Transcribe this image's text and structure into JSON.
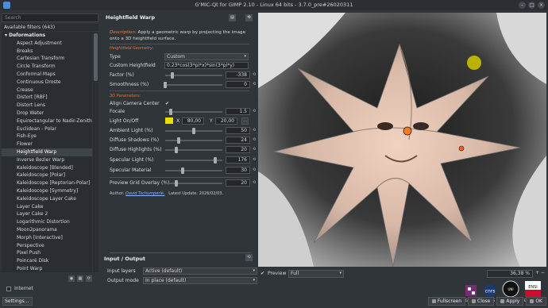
{
  "window": {
    "title": "G'MIC-Qt for GIMP 2.10 - Linux 64 bits - 3.7.0_pre#26020311",
    "controls": [
      "–",
      "□",
      "×"
    ]
  },
  "left": {
    "search_placeholder": "Search",
    "available": "Available filters (643)",
    "category": "Deformations",
    "items": [
      "Aspect Adjustment",
      "Breaks",
      "Cartesian Transform",
      "Circle Transform",
      "Conformal Maps",
      "Continuous Droste",
      "Crease",
      "Distort [RBF]",
      "Distort Lens",
      "Drop Water",
      "Equirectangular to Nadir-Zenith",
      "Euclidean - Polar",
      "Fish-Eye",
      "Flower",
      "Heightfield Warp",
      "Inverse Bezier Warp",
      "Kaleidoscope [Blended]",
      "Kaleidoscope [Polar]",
      "Kaleidoscope [Reptorian-Polar]",
      "Kaleidoscope [Symmetry]",
      "Kaleidoscope Layer Cake",
      "Layer Cake",
      "Layer Cake 2",
      "Logarithmic Distortion",
      "Moon2panorama",
      "Morph [Interactive]",
      "Perspective",
      "Pixel Push",
      "Poincaré Disk",
      "Point Warp"
    ],
    "selected_index": 14,
    "internet_label": "Internet",
    "settings_label": "Settings..."
  },
  "filter": {
    "name": "Heightfield Warp",
    "desc_label": "Description:",
    "desc_text": "Apply a geometric warp by projecting the image onto a 3D heightfield surface.",
    "sec_geometry": "Heightfield Geometry:",
    "type_label": "Type",
    "type_value": "Custom",
    "custom_label": "Custom Heightfield",
    "custom_value": "0.23*cos(3*pi*x)*sin(3*pi*y)",
    "factor_label": "Factor (%)",
    "factor_value": "-338",
    "factor_pos": 0.13,
    "smooth_label": "Smoothness (%)",
    "smooth_value": "0",
    "smooth_pos": 0.0,
    "sec_3d": "3D Parameters:",
    "align_label": "Align Camera Center",
    "align_checked": true,
    "focale_label": "Focale",
    "focale_value": "1.5",
    "focale_pos": 0.1,
    "light_label": "Light On/Off",
    "light_color": "#e8e000",
    "light_x_label": "X",
    "light_x": "80,00",
    "light_y_label": "Y",
    "light_y": "20,00",
    "ambient_label": "Ambient Light (%)",
    "ambient_value": "50",
    "ambient_pos": 0.5,
    "shadows_label": "Diffuse Shadows (%)",
    "shadows_value": "24",
    "shadows_pos": 0.24,
    "highlights_label": "Diffuse Highlights (%)",
    "highlights_value": "20",
    "highlights_pos": 0.2,
    "specular_label": "Specular Light (%)",
    "specular_value": "176",
    "specular_pos": 0.88,
    "material_label": "Specular Material",
    "material_value": "30",
    "material_pos": 0.3,
    "grid_label": "Preview Grid Overlay (%)",
    "grid_value": "20",
    "grid_pos": 0.2,
    "author_label": "Author:",
    "author_name": "David Tschumperlé.",
    "update": "Latest Update: 2026/02/03."
  },
  "io": {
    "title": "Input / Output",
    "layers_label": "Input layers",
    "layers_value": "Active (default)",
    "mode_label": "Output mode",
    "mode_value": "In place (default)"
  },
  "preview": {
    "label": "Preview",
    "checked": true,
    "mode": "Full",
    "zoom": "36,38 %",
    "logos": [
      "GREYC",
      "CNRS",
      "UNICAEN",
      "ENSICAEN"
    ]
  },
  "buttons": {
    "fullscreen": "Fullscreen",
    "close": "Close",
    "apply": "Apply",
    "ok": "OK"
  },
  "colors": {
    "accent": "#ff6a2a",
    "selection": "#3f4449",
    "bg": "#30353a"
  }
}
